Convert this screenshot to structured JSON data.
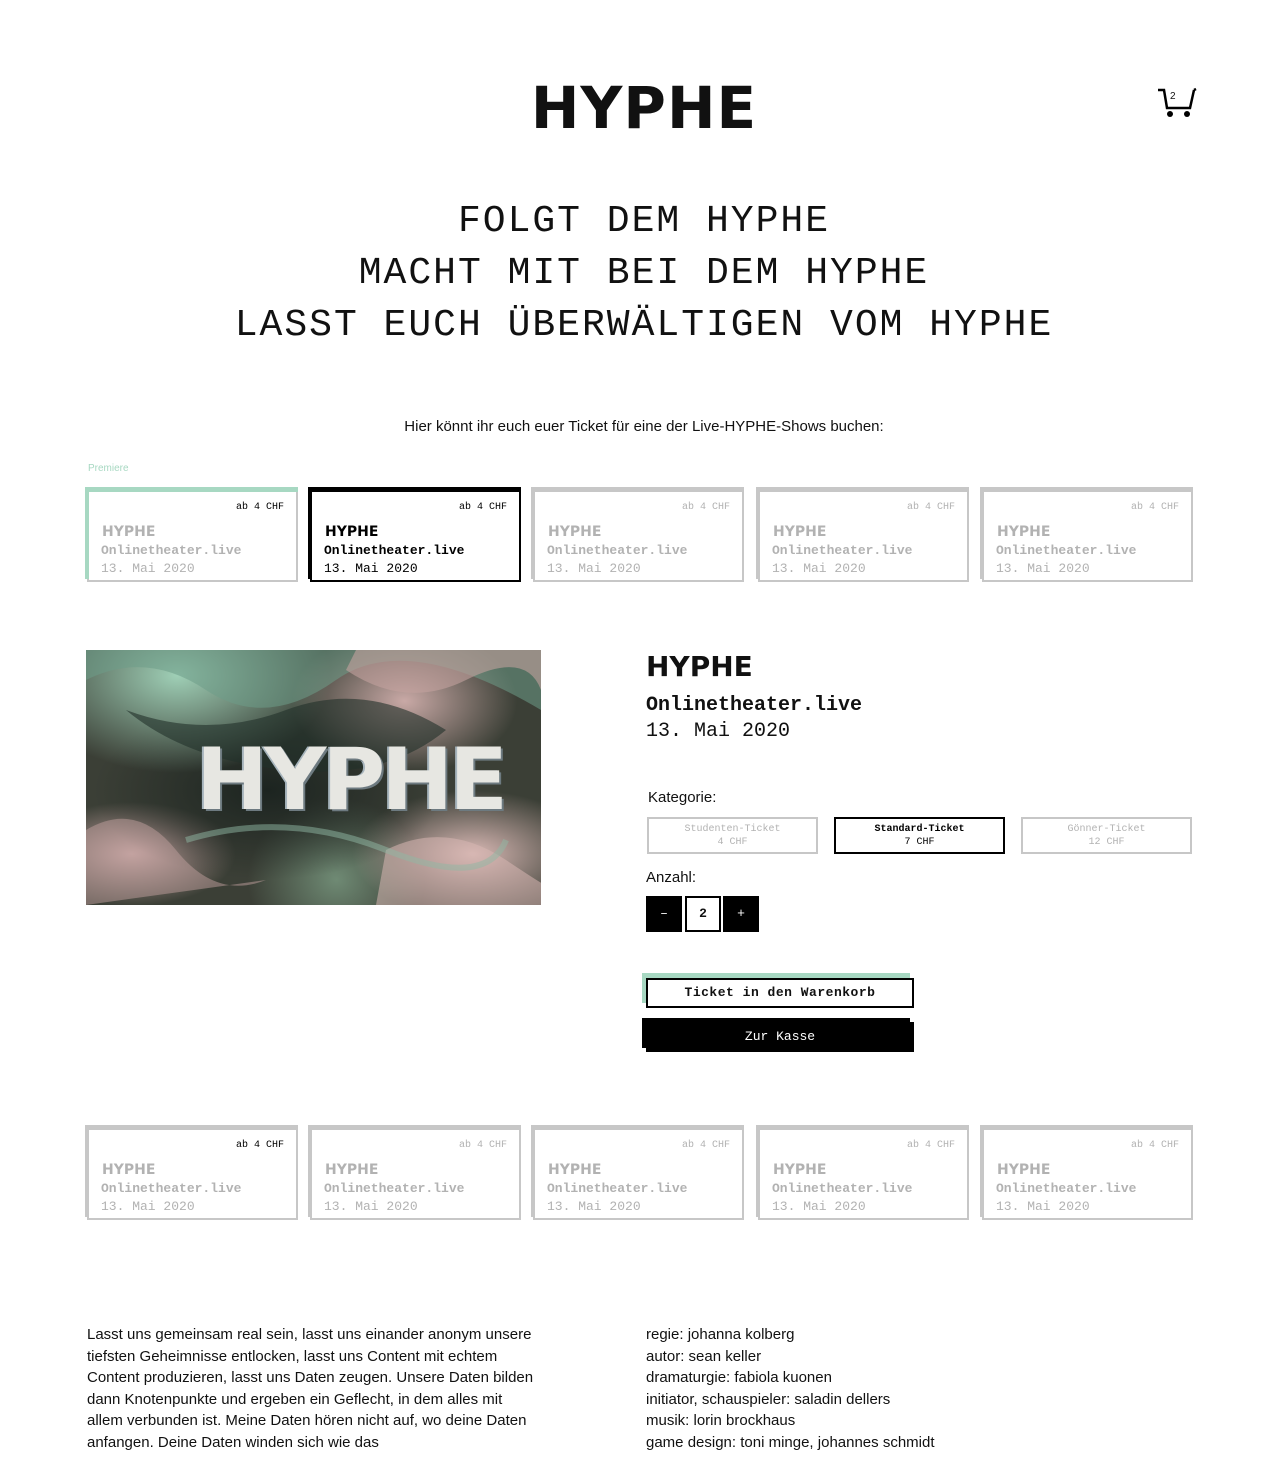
{
  "header": {
    "logo": "HYPHE",
    "cart_count": "2"
  },
  "headline": {
    "line1": "FOLGT DEM HYPHE",
    "line2": "MACHT MIT BEI DEM HYPHE",
    "line3": "LASST EUCH ÜBERWÄLTIGEN VOM HYPHE"
  },
  "intro": "Hier könnt ihr euch euer Ticket für eine der Live-HYPHE-Shows buchen:",
  "premiere_label": "Premiere",
  "shows_top": [
    {
      "price": "ab 4 CHF",
      "title": "HYPHE",
      "venue": "Onlinetheater.live",
      "date": "13. Mai 2020"
    },
    {
      "price": "ab 4 CHF",
      "title": "HYPHE",
      "venue": "Onlinetheater.live",
      "date": "13. Mai 2020"
    },
    {
      "price": "ab 4 CHF",
      "title": "HYPHE",
      "venue": "Onlinetheater.live",
      "date": "13. Mai 2020"
    },
    {
      "price": "ab 4 CHF",
      "title": "HYPHE",
      "venue": "Onlinetheater.live",
      "date": "13. Mai 2020"
    },
    {
      "price": "ab 4 CHF",
      "title": "HYPHE",
      "venue": "Onlinetheater.live",
      "date": "13. Mai 2020"
    }
  ],
  "detail": {
    "title": "HYPHE",
    "venue": "Onlinetheater.live",
    "date": "13. Mai 2020",
    "category_label": "Kategorie:",
    "categories": [
      {
        "name": "Studenten-Ticket",
        "price": "4 CHF"
      },
      {
        "name": "Standard-Ticket",
        "price": "7 CHF"
      },
      {
        "name": "Gönner-Ticket",
        "price": "12 CHF"
      }
    ],
    "quantity_label": "Anzahl:",
    "minus": "–",
    "quantity": "2",
    "plus": "+",
    "add_to_cart": "Ticket in den Warenkorb",
    "checkout": "Zur Kasse"
  },
  "shows_bottom": [
    {
      "price": "ab 4 CHF",
      "title": "HYPHE",
      "venue": "Onlinetheater.live",
      "date": "13. Mai 2020"
    },
    {
      "price": "ab 4 CHF",
      "title": "HYPHE",
      "venue": "Onlinetheater.live",
      "date": "13. Mai 2020"
    },
    {
      "price": "ab 4 CHF",
      "title": "HYPHE",
      "venue": "Onlinetheater.live",
      "date": "13. Mai 2020"
    },
    {
      "price": "ab 4 CHF",
      "title": "HYPHE",
      "venue": "Onlinetheater.live",
      "date": "13. Mai 2020"
    },
    {
      "price": "ab 4 CHF",
      "title": "HYPHE",
      "venue": "Onlinetheater.live",
      "date": "13. Mai 2020"
    }
  ],
  "about": "Lasst uns gemeinsam real sein, lasst uns einander anonym unsere tiefsten Geheimnisse entlocken, lasst uns Content mit echtem Content produzieren, lasst uns Daten zeugen. Unsere Daten bilden dann Knotenpunkte und ergeben ein Geflecht, in dem alles mit allem verbunden ist. Meine Daten hören nicht auf, wo deine Daten anfangen. Deine Daten winden sich wie das",
  "credits": [
    "regie: johanna kolberg",
    "autor: sean keller",
    "dramaturgie: fabiola kuonen",
    "initiator, schauspieler: saladin dellers",
    "musik: lorin brockhaus",
    "game design: toni minge, johannes schmidt"
  ]
}
